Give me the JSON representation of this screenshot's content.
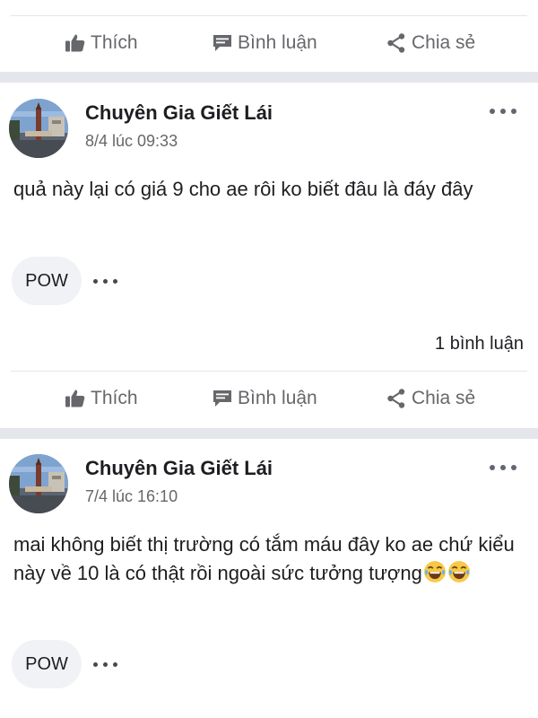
{
  "actions": {
    "like_label": "Thích",
    "comment_label": "Bình luận",
    "share_label": "Chia sẻ"
  },
  "colors": {
    "text_primary": "#1c1e21",
    "text_secondary": "#65676b",
    "separator": "#e4e6eb",
    "pill_background": "#f0f2f5"
  },
  "posts": [
    {
      "author": "Chuyên Gia Giết Lái",
      "timestamp": "8/4 lúc 09:33",
      "text": "quả này lại có giá 9 cho ae rôi ko biết đâu là đáy đây",
      "tag": "POW",
      "comment_count": "1 bình luận"
    },
    {
      "author": "Chuyên Gia Giết Lái",
      "timestamp": "7/4 lúc 16:10",
      "text": "mai không biết thị trường có tắm máu đây ko ae chứ kiểu này về 10 là có thật rồi ngoài sức tưởng tượng",
      "emoji": [
        "😂",
        "😂"
      ],
      "tag": "POW"
    }
  ],
  "icons": [
    "thumbs-up-icon",
    "comment-icon",
    "share-icon",
    "more-options-icon",
    "laughing-emoji-icon"
  ]
}
